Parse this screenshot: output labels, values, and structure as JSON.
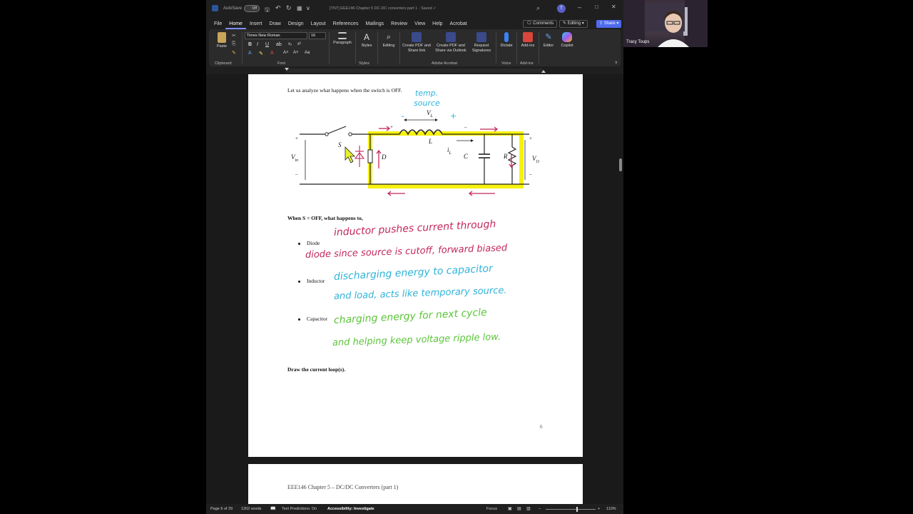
{
  "titlebar": {
    "autosave_label": "AutoSave",
    "autosave_state": "Off",
    "doc_title": "[TNT] EEE146 Chapter 5 DC-DC converters part 1 · Saved ✓",
    "avatar_initial": "T"
  },
  "menu": {
    "items": [
      "File",
      "Home",
      "Insert",
      "Draw",
      "Design",
      "Layout",
      "References",
      "Mailings",
      "Review",
      "View",
      "Help",
      "Acrobat"
    ],
    "active": "Home",
    "comments_label": "Comments",
    "editing_label": "Editing",
    "share_label": "Share"
  },
  "ribbon": {
    "paste_label": "Paste",
    "font_name": "Times New Roman",
    "font_size": "16",
    "paragraph_label": "Paragraph",
    "styles_label": "Styles",
    "editing_label": "Editing",
    "create_pdf_share": "Create PDF and Share link",
    "create_pdf_outlook": "Create PDF and Share via Outlook",
    "request_signatures": "Request Signatures",
    "dictate_label": "Dictate",
    "addins_label": "Add-ins",
    "editor_label": "Editor",
    "copilot_label": "Copilot",
    "groups": {
      "clipboard": "Clipboard",
      "font": "Font",
      "styles": "Styles",
      "adobe": "Adobe Acrobat",
      "voice": "Voice",
      "addins": "Add-ins"
    },
    "colors": {
      "accent": "#7b8cff",
      "adobe_red": "#d9463b",
      "dictate_blue": "#3b82f6"
    }
  },
  "document": {
    "intro": "Let us analyze what happens when the switch is OFF.",
    "circuit": {
      "vin": "V",
      "vin_sub": "in",
      "switch": "S",
      "diode": "D",
      "inductor": "L",
      "vl": "V",
      "vl_sub": "L",
      "il": "i",
      "il_sub": "L",
      "capacitor": "C",
      "resistor": "R",
      "vo": "V",
      "vo_sub": "O",
      "plus": "+",
      "minus": "–"
    },
    "annotation_temp_source": [
      "temp.",
      "source"
    ],
    "question": "When S = OFF, what happens to,",
    "bullets": [
      {
        "label": "Diode",
        "notes": [
          "inductor pushes current through",
          "diode since source is cutoff, forward biased"
        ],
        "color": "#c4265e"
      },
      {
        "label": "Inductor",
        "notes": [
          "discharging energy to capacitor",
          "and load, acts like temporary source."
        ],
        "color": "#2fb3d9"
      },
      {
        "label": "Capacitor",
        "notes": [
          "charging energy for next cycle",
          "and helping keep voltage ripple low."
        ],
        "color": "#5cc43a"
      }
    ],
    "draw_loops": "Draw the current loop(s).",
    "page_number": "6",
    "next_page_header": "EEE146 Chapter 5 – DC/DC Converters (part 1)",
    "highlight_color": "#f5f000",
    "arrow_color": "#c4265e"
  },
  "statusbar": {
    "page": "Page 6 of 29",
    "words": "1302 words",
    "text_predictions": "Text Predictions: On",
    "accessibility": "Accessibility: Investigate",
    "focus": "Focus",
    "zoom": "110%"
  },
  "webcam": {
    "name": "Tracy Toups"
  }
}
